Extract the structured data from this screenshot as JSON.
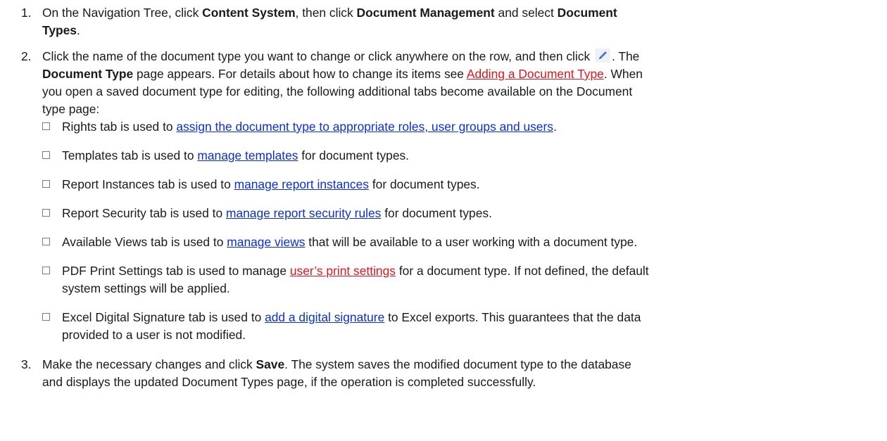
{
  "steps": [
    {
      "number": "1.",
      "parts": [
        "On the Navigation Tree, click ",
        "Content System",
        ", then click ",
        "Document Management",
        " and select ",
        "Document",
        "Types",
        "."
      ]
    },
    {
      "number": "2.",
      "parts": [
        "Click the name of the document type you want to change or click anywhere on the row, and then click ",
        ". The",
        "Document Type",
        " page appears. For details about how to change its items see ",
        "Adding a Document Type",
        ". When",
        "you open a saved document type for editing, the following additional tabs become available on the Document",
        "type page:"
      ],
      "edit_icon": "pencil-icon",
      "bullets": [
        {
          "before": "Rights tab is used to ",
          "link": "assign the document type to appropriate roles, user groups and users",
          "after": "."
        },
        {
          "before": "Templates tab is used to ",
          "link": "manage templates",
          "after": " for document types."
        },
        {
          "before": "Report Instances tab is used to ",
          "link": "manage report instances",
          "after": " for document types."
        },
        {
          "before": "Report Security tab is used to ",
          "link": "manage report security rules",
          "after": " for document types."
        },
        {
          "before": "Available Views tab is used to ",
          "link": "manage views",
          "after": " that will be available to a user working with a document type."
        },
        {
          "before": "PDF Print Settings tab is used to manage ",
          "link": "user’s print settings",
          "after": " for a document type. If not defined, the default",
          "line2": "system settings will be applied."
        },
        {
          "before": "Excel Digital Signature tab is used to ",
          "link": "add a digital signature",
          "after": " to Excel exports. This guarantees that the data",
          "line2": "provided to a user is not modified."
        }
      ]
    },
    {
      "number": "3.",
      "parts": [
        "Make the necessary changes and click ",
        "Save",
        ". The system saves the modified document type to the database",
        "and displays the updated Document Types page, if the operation is completed successfully."
      ]
    }
  ],
  "colors": {
    "text": "#1a1a1a",
    "link_blue": "#0b2fd3",
    "link_red": "#e0151b"
  }
}
